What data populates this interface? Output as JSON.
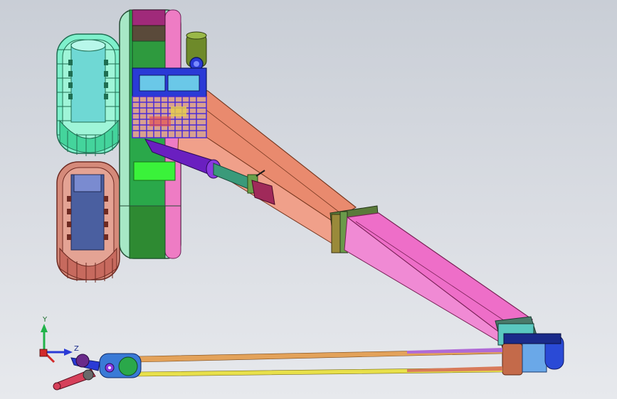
{
  "viewport": {
    "background_top": "#c9ced6",
    "background_bottom": "#e7e9ed"
  },
  "triad": {
    "y_label": "Y",
    "z_label": "Z",
    "y_color": "#21b34a",
    "z_color": "#2a3ad6",
    "x_color": "#d22a2a"
  },
  "palette": {
    "track_front": "#4fe0b0",
    "track_rear": "#c97a6a",
    "boom_base": "#e98a6e",
    "boom_tip": "#ee6ec8",
    "cylinder": "#6a1fc0",
    "rod_orange": "#e3a25a",
    "rod_yellow": "#e8e04a",
    "guard": "#4a2ad6",
    "turntable_green": "#2aa84a",
    "turntable_pink": "#ee7cc4"
  }
}
